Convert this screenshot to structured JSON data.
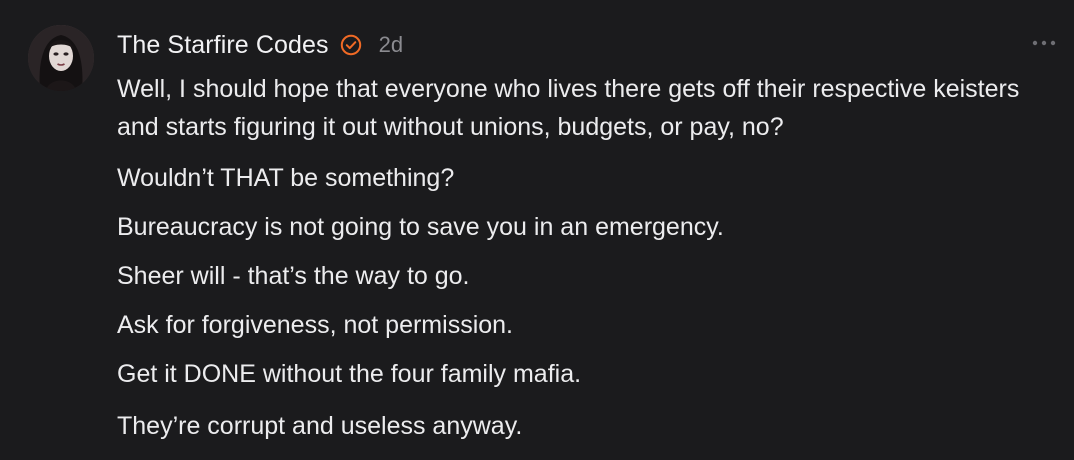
{
  "comment": {
    "author": "The Starfire Codes",
    "time": "2d",
    "avatar_icon": "profile-photo",
    "badge_icon": "verified-check-icon",
    "badge_color": "#f06a25",
    "menu_icon": "more-horizontal-icon",
    "paragraphs": [
      "Well, I should hope that everyone who lives there gets off their respective keisters and starts figuring it out without unions, budgets, or pay, no?",
      "Wouldn’t THAT be something?",
      "Bureaucracy is not going to save you in an emergency.",
      "Sheer will - that’s the way to go.",
      "Ask for forgiveness, not permission.",
      "Get it DONE without the four family mafia.",
      "They’re corrupt and useless anyway."
    ]
  }
}
